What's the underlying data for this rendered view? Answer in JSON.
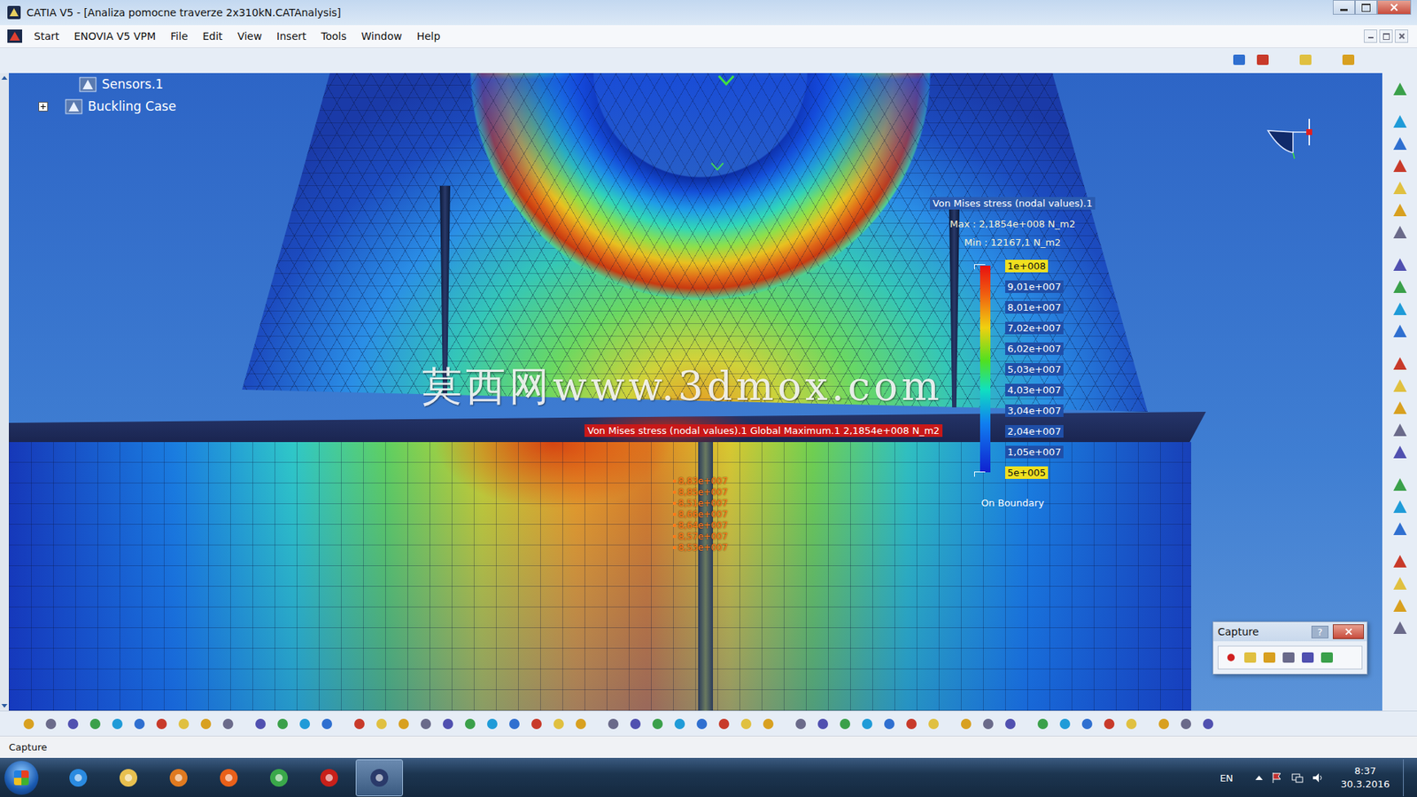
{
  "window": {
    "title": "CATIA V5 - [Analiza pomocne traverze 2x310kN.CATAnalysis]"
  },
  "menu": [
    "Start",
    "ENOVIA V5 VPM",
    "File",
    "Edit",
    "View",
    "Insert",
    "Tools",
    "Window",
    "Help"
  ],
  "tree": [
    {
      "label": "Sensors.1",
      "kind": "leaf"
    },
    {
      "label": "Buckling Case",
      "kind": "branch",
      "expanded": false
    }
  ],
  "legend": {
    "title": "Von Mises stress (nodal values).1",
    "max": "Max : 2,1854e+008 N_m2",
    "min": "Min : 12167,1 N_m2",
    "ticks": [
      {
        "label": "1e+008",
        "highlighted": true
      },
      {
        "label": "9,01e+007",
        "highlighted": false
      },
      {
        "label": "8,01e+007",
        "highlighted": false
      },
      {
        "label": "7,02e+007",
        "highlighted": false
      },
      {
        "label": "6,02e+007",
        "highlighted": false
      },
      {
        "label": "5,03e+007",
        "highlighted": false
      },
      {
        "label": "4,03e+007",
        "highlighted": false
      },
      {
        "label": "3,04e+007",
        "highlighted": false
      },
      {
        "label": "2,04e+007",
        "highlighted": false
      },
      {
        "label": "1,05e+007",
        "highlighted": false
      },
      {
        "label": "5e+005",
        "highlighted": true
      }
    ],
    "footer": "On Boundary"
  },
  "annotation": "Von Mises stress (nodal values).1 Global Maximum.1 2,1854e+008 N_m2",
  "probes": [
    "8,83e+007",
    "8,85e+007",
    "8,51e+007",
    "8,66e+007",
    "8,64e+007",
    "8,57e+007",
    "8,53e+007"
  ],
  "watermark": "莫西网www.3dmox.com",
  "capture_dialog": {
    "title": "Capture",
    "help": "?"
  },
  "status_bar": "Capture",
  "taskbar": {
    "language": "EN",
    "time": "8:37",
    "date": "30.3.2016",
    "apps": [
      {
        "selected": false
      },
      {
        "selected": false
      },
      {
        "selected": false
      },
      {
        "selected": false
      },
      {
        "selected": false
      },
      {
        "selected": false
      },
      {
        "selected": true
      }
    ]
  }
}
